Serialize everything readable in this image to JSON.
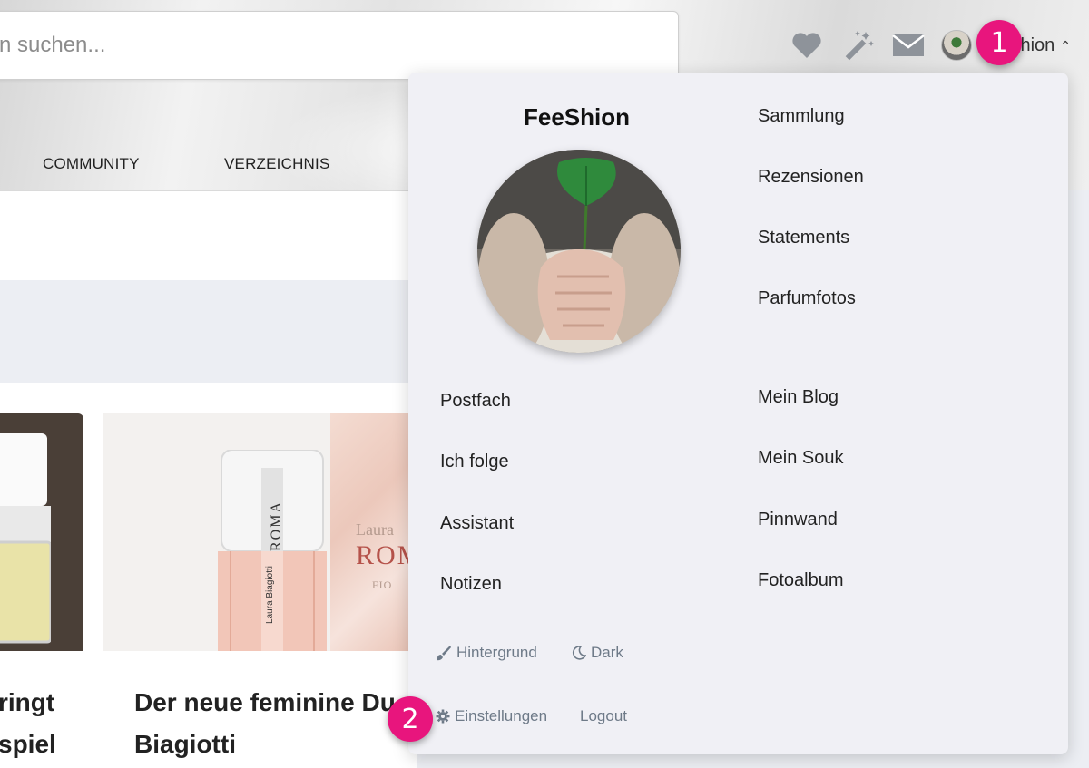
{
  "search": {
    "placeholder": "n suchen..."
  },
  "header": {
    "user_name": "FeeShion"
  },
  "nav": {
    "items": [
      "COMMUNITY",
      "VERZEICHNIS"
    ]
  },
  "cards": [
    {
      "title_line1": "ringt",
      "title_line2": "spiel"
    },
    {
      "title_line1": "Der neue feminine Du",
      "title_line2": "Biagiotti",
      "box_text1": "Laura",
      "box_text2": "ROMA",
      "box_text3": "FIO",
      "bottle_label": "ROMA",
      "bottle_side": "Laura Biagiotti"
    }
  ],
  "dropdown": {
    "username": "FeeShion",
    "right_top": [
      "Sammlung",
      "Rezensionen",
      "Statements",
      "Parfumfotos"
    ],
    "left_bottom": [
      "Postfach",
      "Ich folge",
      "Assistant",
      "Notizen"
    ],
    "right_bottom": [
      "Mein Blog",
      "Mein Souk",
      "Pinnwand",
      "Fotoalbum"
    ],
    "util": {
      "background": "Hintergrund",
      "dark": "Dark",
      "settings": "Einstellungen",
      "logout": "Logout"
    }
  },
  "badges": [
    "1",
    "2"
  ],
  "colors": {
    "badge": "#e8157d",
    "dropdown_bg": "#f0f0f5",
    "util_text": "#6e7a88",
    "icon_gray": "#8e939a"
  }
}
